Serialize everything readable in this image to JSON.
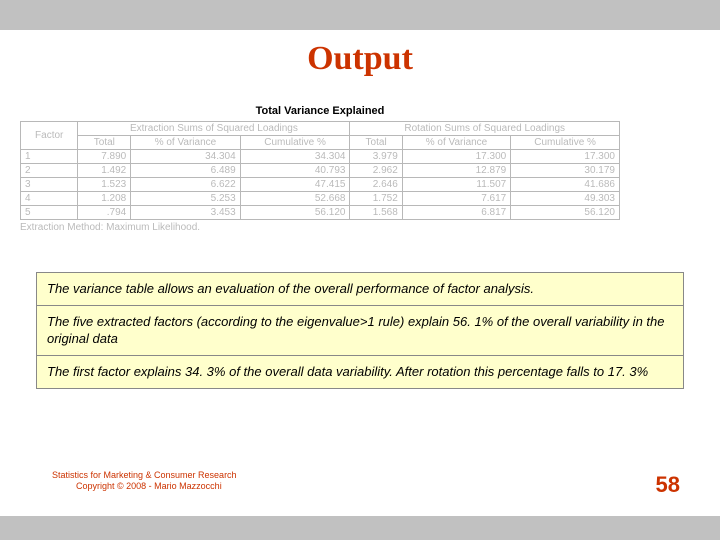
{
  "page": {
    "title": "Output",
    "page_number": "58"
  },
  "table": {
    "caption": "Total Variance Explained",
    "group_headers": {
      "factor": "Factor",
      "extraction": "Extraction Sums of Squared Loadings",
      "rotation": "Rotation Sums of Squared Loadings"
    },
    "sub_headers": {
      "total": "Total",
      "pct": "% of Variance",
      "cum": "Cumulative %"
    },
    "rows": [
      {
        "factor": "1",
        "e_total": "7.890",
        "e_pct": "34.304",
        "e_cum": "34.304",
        "r_total": "3.979",
        "r_pct": "17.300",
        "r_cum": "17.300"
      },
      {
        "factor": "2",
        "e_total": "1.492",
        "e_pct": "6.489",
        "e_cum": "40.793",
        "r_total": "2.962",
        "r_pct": "12.879",
        "r_cum": "30.179"
      },
      {
        "factor": "3",
        "e_total": "1.523",
        "e_pct": "6.622",
        "e_cum": "47.415",
        "r_total": "2.646",
        "r_pct": "11.507",
        "r_cum": "41.686"
      },
      {
        "factor": "4",
        "e_total": "1.208",
        "e_pct": "5.253",
        "e_cum": "52.668",
        "r_total": "1.752",
        "r_pct": "7.617",
        "r_cum": "49.303"
      },
      {
        "factor": "5",
        "e_total": ".794",
        "e_pct": "3.453",
        "e_cum": "56.120",
        "r_total": "1.568",
        "r_pct": "6.817",
        "r_cum": "56.120"
      }
    ],
    "extraction_method": "Extraction Method: Maximum Likelihood."
  },
  "chart_data": {
    "type": "table",
    "title": "Total Variance Explained",
    "columns": [
      "Factor",
      "Extraction Total",
      "Extraction % of Variance",
      "Extraction Cumulative %",
      "Rotation Total",
      "Rotation % of Variance",
      "Rotation Cumulative %"
    ],
    "rows": [
      [
        1,
        7.89,
        34.304,
        34.304,
        3.979,
        17.3,
        17.3
      ],
      [
        2,
        1.492,
        6.489,
        40.793,
        2.962,
        12.879,
        30.179
      ],
      [
        3,
        1.523,
        6.622,
        47.415,
        2.646,
        11.507,
        41.686
      ],
      [
        4,
        1.208,
        5.253,
        52.668,
        1.752,
        7.617,
        49.303
      ],
      [
        5,
        0.794,
        3.453,
        56.12,
        1.568,
        6.817,
        56.12
      ]
    ],
    "note": "Extraction Method: Maximum Likelihood."
  },
  "commentary": {
    "p1": "The variance table allows an evaluation of the overall performance of factor analysis.",
    "p2": "The five extracted factors (according to the eigenvalue>1 rule) explain 56. 1% of the overall variability in the original data",
    "p3": "The first factor explains 34. 3% of the overall data variability. After rotation this percentage falls to 17. 3%"
  },
  "footer": {
    "line1": "Statistics for Marketing & Consumer Research",
    "line2": "Copyright © 2008 - Mario Mazzocchi"
  }
}
